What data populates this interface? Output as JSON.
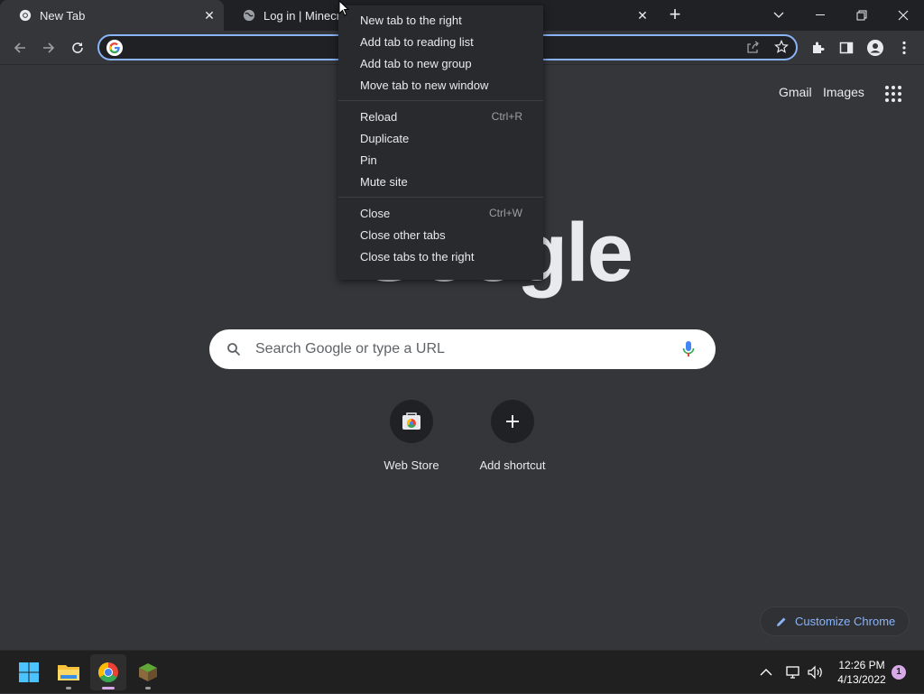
{
  "tabs": [
    {
      "title": "New Tab",
      "icon": "chrome-icon"
    },
    {
      "title": "Log in | Minecraft",
      "icon": "globe-icon"
    }
  ],
  "omnibox": {
    "value": "",
    "placeholder": ""
  },
  "top_links": {
    "gmail": "Gmail",
    "images": "Images"
  },
  "logo_text": "Google",
  "search": {
    "placeholder": "Search Google or type a URL"
  },
  "shortcuts": [
    {
      "label": "Web Store",
      "icon": "web-store-icon"
    },
    {
      "label": "Add shortcut",
      "icon": "plus-icon"
    }
  ],
  "customize": {
    "label": "Customize Chrome"
  },
  "context_menu": {
    "groups": [
      [
        {
          "label": "New tab to the right",
          "shortcut": ""
        },
        {
          "label": "Add tab to reading list",
          "shortcut": ""
        },
        {
          "label": "Add tab to new group",
          "shortcut": ""
        },
        {
          "label": "Move tab to new window",
          "shortcut": ""
        }
      ],
      [
        {
          "label": "Reload",
          "shortcut": "Ctrl+R"
        },
        {
          "label": "Duplicate",
          "shortcut": ""
        },
        {
          "label": "Pin",
          "shortcut": ""
        },
        {
          "label": "Mute site",
          "shortcut": ""
        }
      ],
      [
        {
          "label": "Close",
          "shortcut": "Ctrl+W"
        },
        {
          "label": "Close other tabs",
          "shortcut": ""
        },
        {
          "label": "Close tabs to the right",
          "shortcut": ""
        }
      ]
    ]
  },
  "taskbar": {
    "time": "12:26 PM",
    "date": "4/13/2022",
    "notification_count": "1",
    "apps": [
      "start-icon",
      "file-explorer-icon",
      "chrome-icon",
      "minecraft-icon"
    ]
  },
  "colors": {
    "background": "#35363a",
    "tab_strip": "#202124",
    "accent": "#8ab4f8",
    "menu_bg": "#292a2d"
  }
}
